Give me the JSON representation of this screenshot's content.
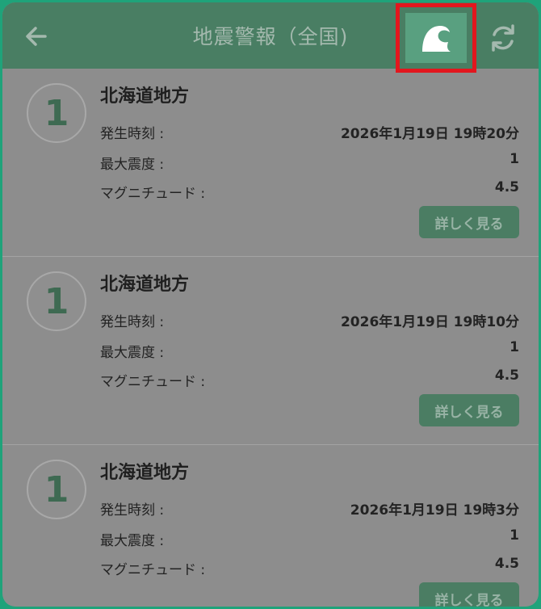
{
  "header": {
    "title": "地震警報（全国)",
    "back_icon": "arrow-left-icon",
    "tsunami_icon": "wave-icon",
    "refresh_icon": "refresh-icon"
  },
  "labels": {
    "time": "発生時刻 :",
    "max_intensity": "最大震度 :",
    "magnitude": "マグニチュード :"
  },
  "items": [
    {
      "badge": "1",
      "region": "北海道地方",
      "time": "2026年1月19日 19時20分",
      "max_intensity": "1",
      "magnitude": "4.5",
      "detail_label": "詳しく見る"
    },
    {
      "badge": "1",
      "region": "北海道地方",
      "time": "2026年1月19日 19時10分",
      "max_intensity": "1",
      "magnitude": "4.5",
      "detail_label": "詳しく見る"
    },
    {
      "badge": "1",
      "region": "北海道地方",
      "time": "2026年1月19日 19時3分",
      "max_intensity": "1",
      "magnitude": "4.5",
      "detail_label": "詳しく見る"
    }
  ],
  "colors": {
    "frame_border": "#1fa37a",
    "header_bg": "#497e63",
    "highlight": "#e2171e",
    "overlay": "#8d8d8d"
  }
}
